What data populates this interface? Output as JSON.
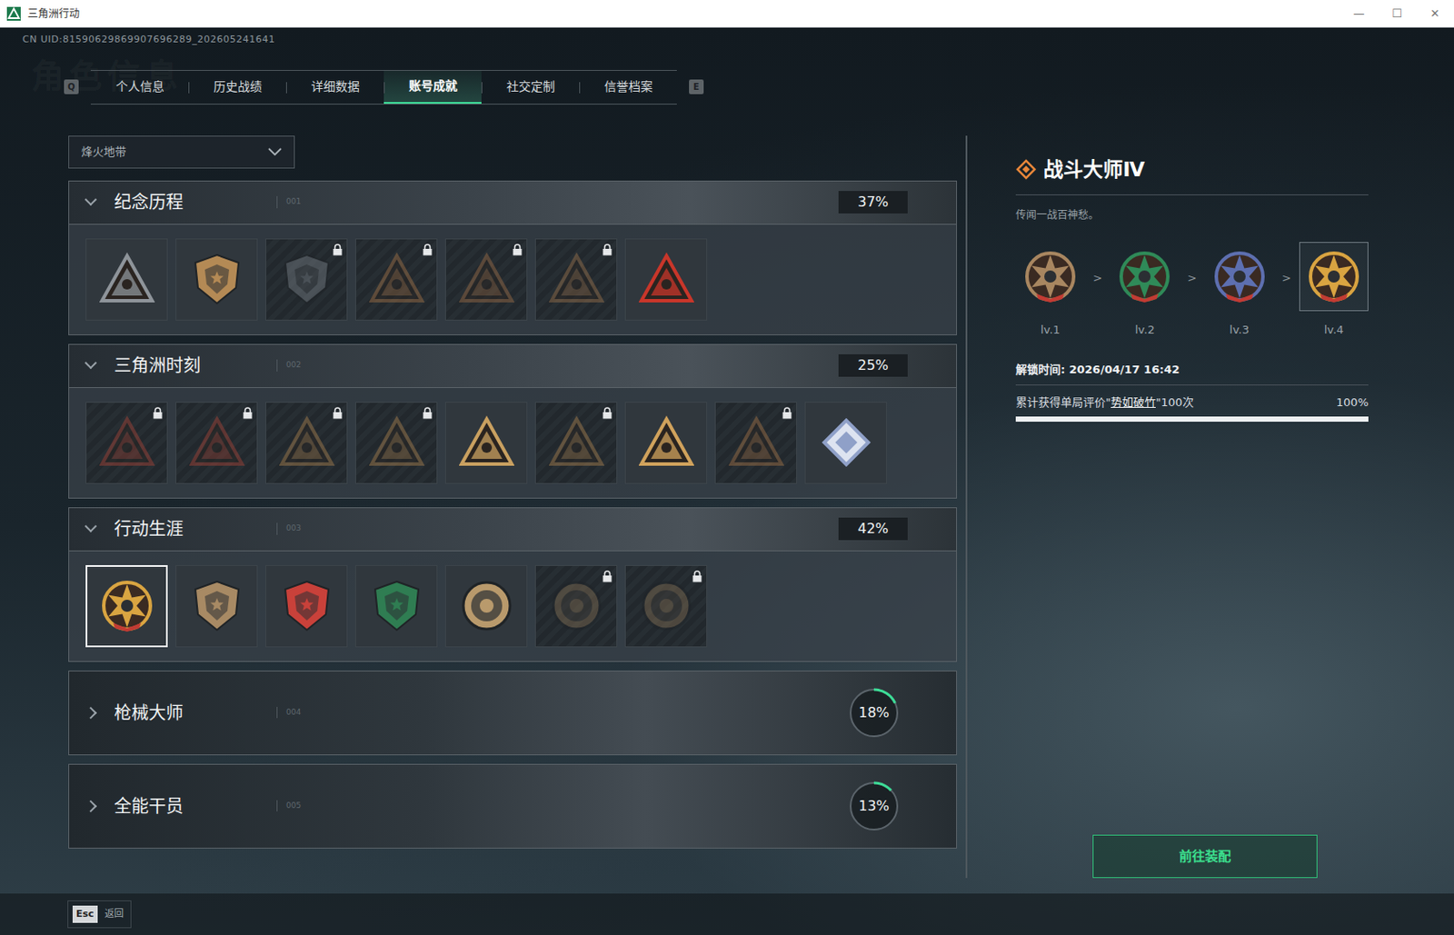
{
  "window": {
    "title": "三角洲行动",
    "controls": [
      "—",
      "☐",
      "✕"
    ]
  },
  "uid": "CN UID:81590629869907696289_202605241641",
  "watermark": "角色信息",
  "tab_keys": [
    "Q",
    "E"
  ],
  "tabs": [
    {
      "label": "个人信息",
      "selected": false
    },
    {
      "label": "历史战绩",
      "selected": false
    },
    {
      "label": "详细数据",
      "selected": false
    },
    {
      "label": "账号成就",
      "selected": true
    },
    {
      "label": "社交定制",
      "selected": false
    },
    {
      "label": "信誉档案",
      "selected": false
    }
  ],
  "mode_select": {
    "value": "烽火地带"
  },
  "categories": [
    {
      "title": "纪念历程",
      "code": "001",
      "percent": "37%",
      "expanded": true,
      "badges": [
        {
          "kind": "triangle",
          "color": "#8e949a",
          "locked": false,
          "selected": false
        },
        {
          "kind": "shield",
          "color": "#b48a55",
          "locked": false,
          "selected": false
        },
        {
          "kind": "shield",
          "color": "#7d858c",
          "locked": true,
          "selected": false
        },
        {
          "kind": "triangle",
          "color": "#b07a4a",
          "locked": true,
          "selected": false
        },
        {
          "kind": "triangle",
          "color": "#a8744a",
          "locked": true,
          "selected": false
        },
        {
          "kind": "triangle",
          "color": "#a67a50",
          "locked": true,
          "selected": false
        },
        {
          "kind": "triangle",
          "color": "#c8362a",
          "locked": false,
          "selected": false
        }
      ]
    },
    {
      "title": "三角洲时刻",
      "code": "002",
      "percent": "25%",
      "expanded": true,
      "badges": [
        {
          "kind": "triangle",
          "color": "#b4483a",
          "locked": true,
          "selected": false
        },
        {
          "kind": "triangle",
          "color": "#b4483a",
          "locked": true,
          "selected": false
        },
        {
          "kind": "triangle",
          "color": "#b78a52",
          "locked": true,
          "selected": false
        },
        {
          "kind": "triangle",
          "color": "#b78a52",
          "locked": true,
          "selected": false
        },
        {
          "kind": "triangle",
          "color": "#c9a060",
          "locked": false,
          "selected": false
        },
        {
          "kind": "triangle",
          "color": "#b78a52",
          "locked": true,
          "selected": false
        },
        {
          "kind": "triangle",
          "color": "#d0a25c",
          "locked": false,
          "selected": false
        },
        {
          "kind": "triangle",
          "color": "#b07a4a",
          "locked": true,
          "selected": false
        },
        {
          "kind": "diamond",
          "color": "#8fa0c8",
          "locked": false,
          "selected": false
        }
      ]
    },
    {
      "title": "行动生涯",
      "code": "003",
      "percent": "42%",
      "expanded": true,
      "badges": [
        {
          "kind": "star",
          "color": "#d9a441",
          "locked": false,
          "selected": true
        },
        {
          "kind": "shield",
          "color": "#a88a64",
          "locked": false,
          "selected": false
        },
        {
          "kind": "shield",
          "color": "#c9413a",
          "locked": false,
          "selected": false
        },
        {
          "kind": "shield",
          "color": "#2f7d52",
          "locked": false,
          "selected": false
        },
        {
          "kind": "circle",
          "color": "#b99a6c",
          "locked": false,
          "selected": false
        },
        {
          "kind": "circle",
          "color": "#8a7356",
          "locked": true,
          "selected": false
        },
        {
          "kind": "circle",
          "color": "#8a7356",
          "locked": true,
          "selected": false
        }
      ]
    },
    {
      "title": "枪械大师",
      "code": "004",
      "percent": "18%",
      "expanded": false,
      "level": 0.18,
      "badges": []
    },
    {
      "title": "全能干员",
      "code": "005",
      "percent": "13%",
      "expanded": false,
      "level": 0.13,
      "badges": []
    }
  ],
  "detail": {
    "title": "战斗大师Ⅳ",
    "description": "传闻一战百神愁。",
    "separator": ">",
    "levels": [
      {
        "label": "lv.1",
        "color": "#a88660",
        "selected": false
      },
      {
        "label": "lv.2",
        "color": "#2f8a58",
        "selected": false
      },
      {
        "label": "lv.3",
        "color": "#5d6fb0",
        "selected": false
      },
      {
        "label": "lv.4",
        "color": "#d9a441",
        "selected": true
      }
    ],
    "unlock": "解锁时间: 2026/04/17 16:42",
    "requirement": {
      "prefix": "累计获得单局评价\"",
      "highlight": "势如破竹",
      "suffix": "\"100次",
      "percent": "100%",
      "level": 1
    },
    "button": "前往装配"
  },
  "footer": {
    "key": "Esc",
    "label": "返回"
  }
}
